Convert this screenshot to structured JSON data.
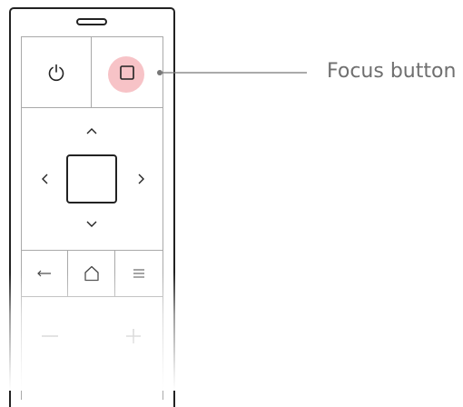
{
  "callout": {
    "label": "Focus button",
    "line_color": "#777777",
    "label_color": "#6f6f6f"
  },
  "remote": {
    "highlight_color": "#f7c3c7",
    "buttons": [
      {
        "name": "power-button",
        "icon": "power-icon"
      },
      {
        "name": "focus-button",
        "icon": "square-icon",
        "highlighted": true
      },
      {
        "name": "dpad-up",
        "icon": "chevron-up-icon"
      },
      {
        "name": "dpad-left",
        "icon": "chevron-left-icon"
      },
      {
        "name": "dpad-center",
        "icon": "select-square"
      },
      {
        "name": "dpad-right",
        "icon": "chevron-right-icon"
      },
      {
        "name": "dpad-down",
        "icon": "chevron-down-icon"
      },
      {
        "name": "back-button",
        "icon": "arrow-left-icon"
      },
      {
        "name": "home-button",
        "icon": "home-icon"
      },
      {
        "name": "menu-button",
        "icon": "hamburger-menu-icon"
      },
      {
        "name": "volume-down-button",
        "icon": "minus-icon"
      },
      {
        "name": "volume-up-button",
        "icon": "plus-icon"
      }
    ]
  }
}
